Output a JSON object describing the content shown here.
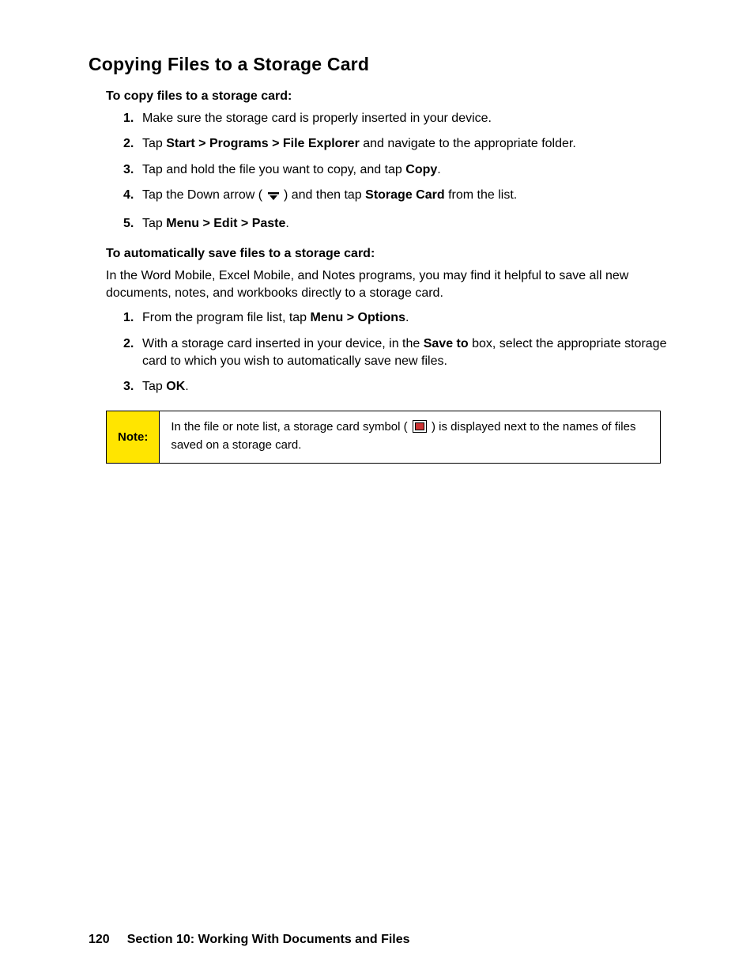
{
  "title": "Copying Files to a Storage Card",
  "section1": {
    "heading": "To copy files to a storage card:",
    "steps": {
      "s1": "Make sure the storage card is properly inserted in your device.",
      "s2a": "Tap ",
      "s2b": "Start > Programs > File Explorer",
      "s2c": " and navigate to the appropriate folder.",
      "s3a": "Tap and hold the file you want to copy, and tap ",
      "s3b": "Copy",
      "s3c": ".",
      "s4a": "Tap the Down arrow ( ",
      "s4b": " ) and then tap ",
      "s4c": "Storage Card",
      "s4d": " from the list.",
      "s5a": "Tap ",
      "s5b": "Menu > Edit > Paste",
      "s5c": "."
    }
  },
  "section2": {
    "heading": "To automatically save files to a storage card:",
    "intro": "In the Word Mobile, Excel Mobile, and Notes programs, you may find it helpful to save all new documents, notes, and workbooks directly to a storage card.",
    "steps": {
      "s1a": "From the program file list, tap ",
      "s1b": "Menu > Options",
      "s1c": ".",
      "s2a": "With a storage card inserted in your device, in the ",
      "s2b": "Save to",
      "s2c": " box, select the appropriate storage card to which you wish to automatically save new files.",
      "s3a": "Tap ",
      "s3b": "OK",
      "s3c": "."
    }
  },
  "note": {
    "label": "Note:",
    "pre": "In the file or note list, a storage card symbol ( ",
    "post": " ) is displayed next to the names of files saved on a storage card."
  },
  "footer": {
    "page": "120",
    "section": "Section 10: Working With Documents and Files"
  },
  "nums": {
    "n1": "1.",
    "n2": "2.",
    "n3": "3.",
    "n4": "4.",
    "n5": "5."
  }
}
